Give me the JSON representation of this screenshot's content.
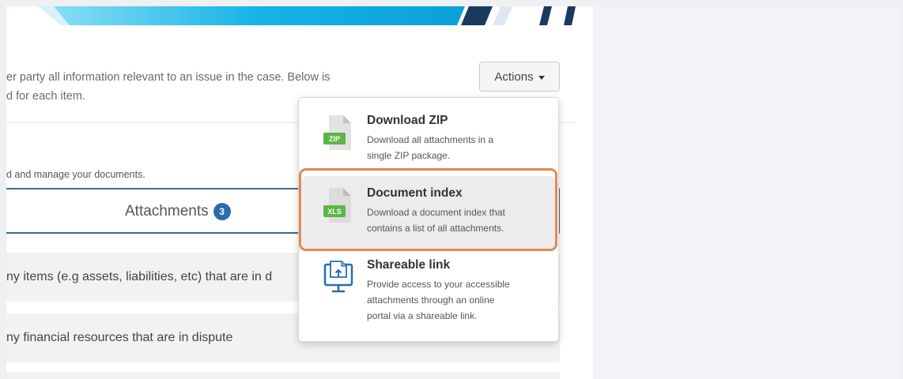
{
  "intro": {
    "line1": "er party all information relevant to an issue in the case. Below is",
    "line2": "d for each item."
  },
  "actions": {
    "label": "Actions"
  },
  "documents": {
    "hint": "d and manage your documents."
  },
  "tab": {
    "label": "Attachments",
    "badge": "3"
  },
  "rows": [
    {
      "text": "ny items (e.g assets, liabilities, etc) that are in d"
    },
    {
      "text": "ny financial resources that are in dispute"
    },
    {
      "text": ""
    }
  ],
  "menu": {
    "items": [
      {
        "icon": "zip-file-icon",
        "icon_tag": "ZIP",
        "title": "Download ZIP",
        "desc_lines": [
          "Download all attachments in a",
          "single ZIP package."
        ]
      },
      {
        "icon": "xls-file-icon",
        "icon_tag": "XLS",
        "title": "Document index",
        "desc_lines": [
          "Download a document index that",
          "contains a list of all attachments."
        ]
      },
      {
        "icon": "shareable-link-icon",
        "title": "Shareable link",
        "desc_lines": [
          "Provide access to your accessible",
          "attachments through an online",
          "portal via a shareable link."
        ]
      }
    ]
  },
  "colors": {
    "accent": "#2b6cb0",
    "tag_green": "#5cb547",
    "highlight": "#e58752",
    "tab_border": "#3d6b8f"
  }
}
